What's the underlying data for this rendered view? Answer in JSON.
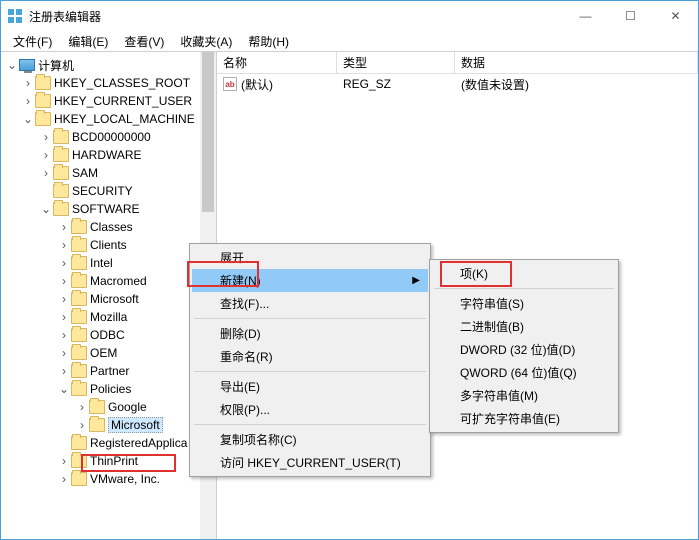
{
  "window": {
    "title": "注册表编辑器"
  },
  "menu": {
    "file": "文件(F)",
    "edit": "编辑(E)",
    "view": "查看(V)",
    "fav": "收藏夹(A)",
    "help": "帮助(H)"
  },
  "tree": {
    "computer": "计算机",
    "hkcr": "HKEY_CLASSES_ROOT",
    "hkcu": "HKEY_CURRENT_USER",
    "hklm": "HKEY_LOCAL_MACHINE",
    "bcd": "BCD00000000",
    "hardware": "HARDWARE",
    "sam": "SAM",
    "security": "SECURITY",
    "software": "SOFTWARE",
    "classes": "Classes",
    "clients": "Clients",
    "intel": "Intel",
    "macromed": "Macromed",
    "microsoft": "Microsoft",
    "mozilla": "Mozilla",
    "odbc": "ODBC",
    "oem": "OEM",
    "partner": "Partner",
    "policies": "Policies",
    "google": "Google",
    "pmicrosoft": "Microsoft",
    "regapp": "RegisteredApplica",
    "thinprint": "ThinPrint",
    "vmware": "VMware, Inc."
  },
  "list": {
    "hdr": {
      "name": "名称",
      "type": "类型",
      "data": "数据"
    },
    "row0": {
      "name": "(默认)",
      "type": "REG_SZ",
      "data": "(数值未设置)",
      "icon": "ab"
    }
  },
  "ctx1": {
    "expand": "展开",
    "new": "新建(N)",
    "find": "查找(F)...",
    "delete": "删除(D)",
    "rename": "重命名(R)",
    "export": "导出(E)",
    "perm": "权限(P)...",
    "copyname": "复制项名称(C)",
    "gohkcu": "访问 HKEY_CURRENT_USER(T)"
  },
  "ctx2": {
    "key": "项(K)",
    "string": "字符串值(S)",
    "binary": "二进制值(B)",
    "dword": "DWORD (32 位)值(D)",
    "qword": "QWORD (64 位)值(Q)",
    "multi": "多字符串值(M)",
    "expand": "可扩充字符串值(E)"
  }
}
